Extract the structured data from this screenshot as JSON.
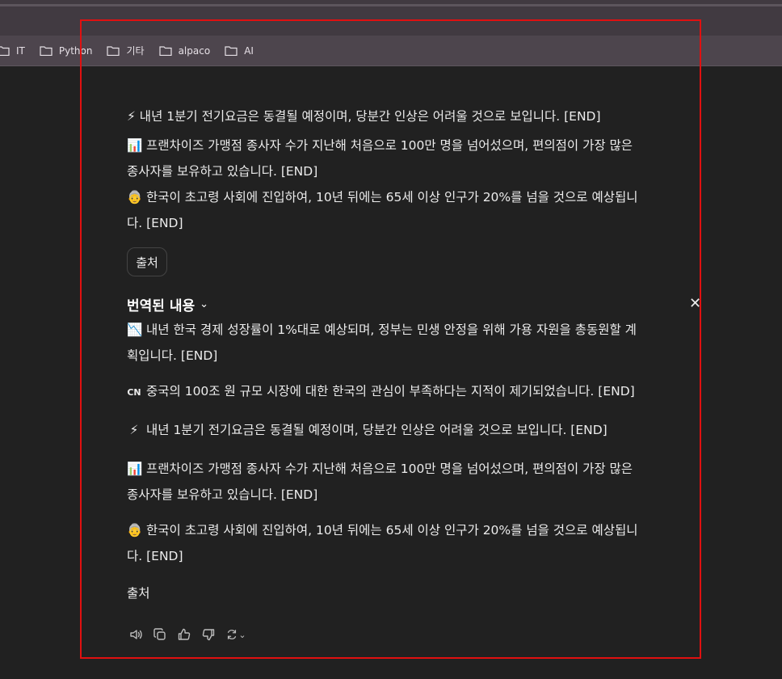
{
  "bookmarks": [
    "IT",
    "Python",
    "기타",
    "alpaco",
    "AI"
  ],
  "top_partial": {
    "line_cut": "⚡ 내년 1분기 전기요금은 동결될 예정이며, 당분간 인상은 어려울 것으로 보입니다. [END]",
    "items": [
      {
        "emoji": "📊",
        "line1": "프랜차이즈 가맹점 종사자 수가 지난해 처음으로 100만 명을 넘어섰으며, 편의점이 가장 많은",
        "line2": "종사자를 보유하고 있습니다. [END]"
      },
      {
        "emoji": "👵",
        "line1": "한국이 초고령 사회에 진입하여, 10년 뒤에는 65세 이상 인구가 20%를 넘을 것으로 예상됩니",
        "line2": "다. [END]"
      }
    ],
    "source_button": "출처"
  },
  "translated": {
    "heading": "번역된 내용",
    "items": [
      {
        "emoji": "📉",
        "line1": "내년 한국 경제 성장률이 1%대로 예상되며, 정부는 민생 안정을 위해 가용 자원을 총동원할 계",
        "line2": "획입니다. [END]"
      },
      {
        "emoji": "CN",
        "line1": "중국의 100조 원 규모 시장에 대한 한국의 관심이 부족하다는 지적이 제기되었습니다. [END]",
        "line2": ""
      },
      {
        "emoji": "⚡",
        "line1": "내년 1분기 전기요금은 동결될 예정이며, 당분간 인상은 어려울 것으로 보입니다. [END]",
        "line2": ""
      },
      {
        "emoji": "📊",
        "line1": "프랜차이즈 가맹점 종사자 수가 지난해 처음으로 100만 명을 넘어섰으며, 편의점이 가장 많은",
        "line2": "종사자를 보유하고 있습니다. [END]"
      },
      {
        "emoji": "👵",
        "line1": "한국이 초고령 사회에 진입하여, 10년 뒤에는 65세 이상 인구가 20%를 넘을 것으로 예상됩니",
        "line2": "다. [END]"
      }
    ],
    "source_label": "출처"
  },
  "actions": [
    "speaker-icon",
    "copy-icon",
    "thumbs-up-icon",
    "thumbs-down-icon",
    "regenerate-icon"
  ]
}
